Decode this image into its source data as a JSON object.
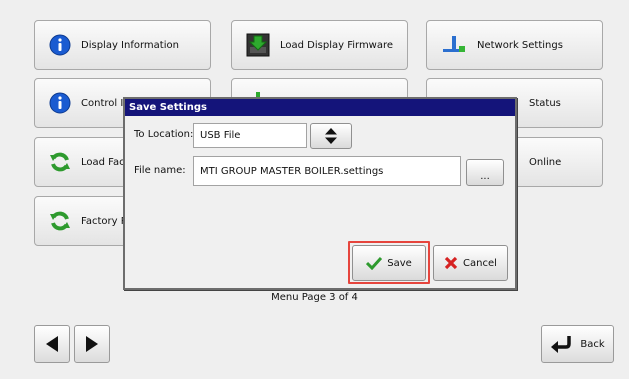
{
  "menu": {
    "buttons": [
      {
        "label": "Display Information",
        "icon": "info-icon"
      },
      {
        "label": "Load Display Firmware",
        "icon": "download-icon"
      },
      {
        "label": "Network Settings",
        "icon": "network-icon"
      },
      {
        "label": "Control In",
        "icon": "info-icon"
      },
      {
        "label": "Status",
        "icon": "status-icon"
      },
      {
        "label": "Load Fac",
        "icon": "refresh-icon"
      },
      {
        "label": "Online",
        "icon": "online-icon"
      },
      {
        "label": "Factory R",
        "icon": "refresh-icon"
      }
    ],
    "page_label": "Menu Page 3 of 4",
    "back_label": "Back"
  },
  "dialog": {
    "title": "Save Settings",
    "location_label": "To Location:",
    "location_value": "USB File",
    "filename_label": "File name:",
    "filename_value": "MTI GROUP MASTER BOILER.settings",
    "browse_label": "...",
    "save_label": "Save",
    "cancel_label": "Cancel"
  },
  "colors": {
    "title_bar": "#14147a",
    "info_blue": "#1a5bd1",
    "refresh_green": "#2e9a2e",
    "highlight_red": "#e6453d",
    "cancel_red": "#d62222"
  }
}
